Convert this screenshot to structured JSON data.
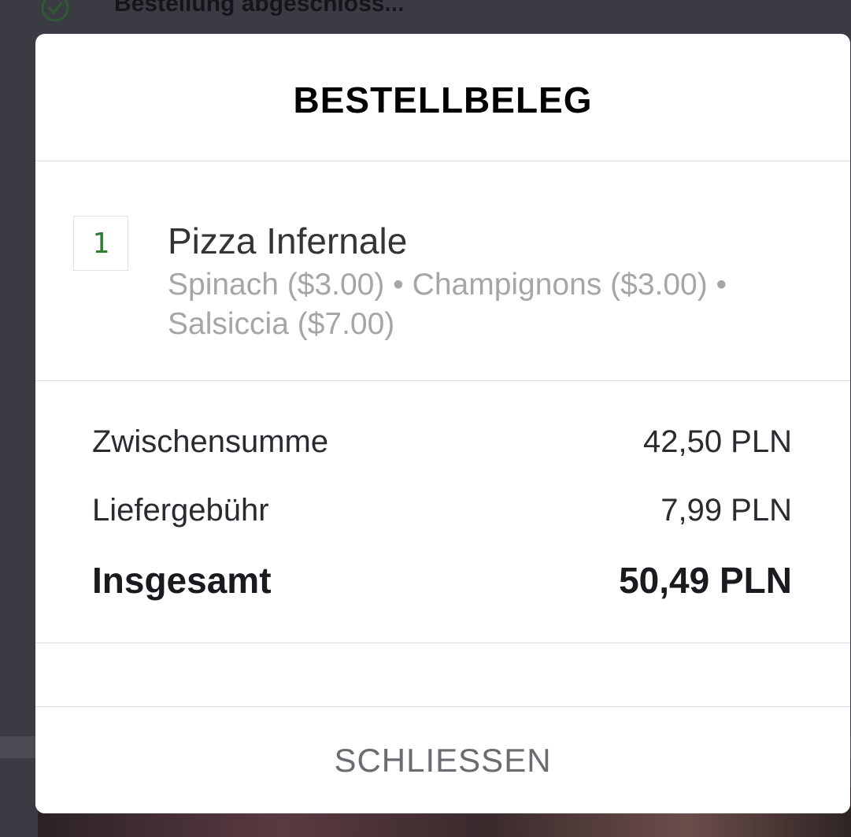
{
  "background": {
    "status_text": "Bestellung abgeschloss..."
  },
  "modal": {
    "title": "BESTELLBELEG",
    "item": {
      "quantity": "1",
      "name": "Pizza Infernale",
      "options": "Spinach ($3.00) • Champignons ($3.00) • Salsiccia ($7.00)"
    },
    "totals": {
      "subtotal_label": "Zwischensumme",
      "subtotal_value": "42,50 PLN",
      "delivery_label": "Liefergebühr",
      "delivery_value": "7,99 PLN",
      "total_label": "Insgesamt",
      "total_value": "50,49 PLN"
    },
    "close_label": "SCHLIESSEN"
  },
  "colors": {
    "accent_green": "#2e7d32",
    "overlay": "#3b3b44"
  }
}
